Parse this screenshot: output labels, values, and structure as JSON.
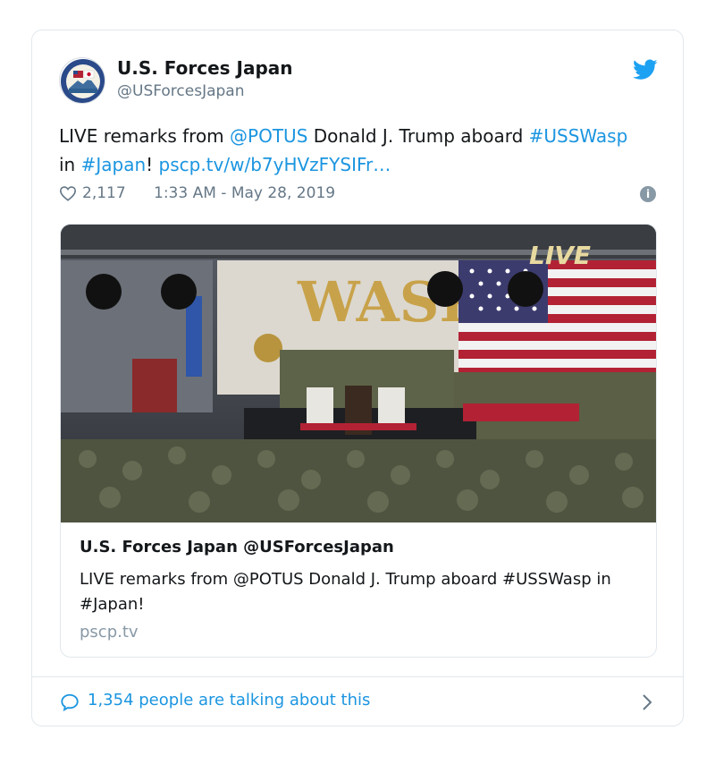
{
  "author": {
    "display_name": "U.S. Forces Japan",
    "handle": "@USForcesJapan"
  },
  "tweet": {
    "text_1": "LIVE remarks from ",
    "mention": "@POTUS",
    "text_2": " Donald J. Trump aboard ",
    "hashtag_1": "#USSWasp",
    "text_3": " in ",
    "hashtag_2": "#Japan",
    "text_4": "! ",
    "link": "pscp.tv/w/b7yHVzFYSIFr…"
  },
  "meta": {
    "likes": "2,117",
    "timestamp": "1:33 AM - May 28, 2019",
    "info_glyph": "i"
  },
  "media": {
    "live_badge": "LIVE",
    "backdrop_text": "WASP"
  },
  "link_card": {
    "title": "U.S. Forces Japan @USForcesJapan",
    "description": "LIVE remarks from @POTUS Donald J. Trump aboard #USSWasp in #Japan!",
    "domain": "pscp.tv"
  },
  "footer": {
    "conversation_text": "1,354 people are talking about this"
  },
  "icons": {
    "bird": "twitter-bird-icon",
    "heart": "heart-icon",
    "info": "info-icon",
    "speech": "speech-bubble-icon",
    "chevron": "chevron-right-icon"
  },
  "colors": {
    "link_blue": "#1b95e0",
    "text": "#14171a",
    "muted": "#657786",
    "border": "#e1e8ed"
  }
}
